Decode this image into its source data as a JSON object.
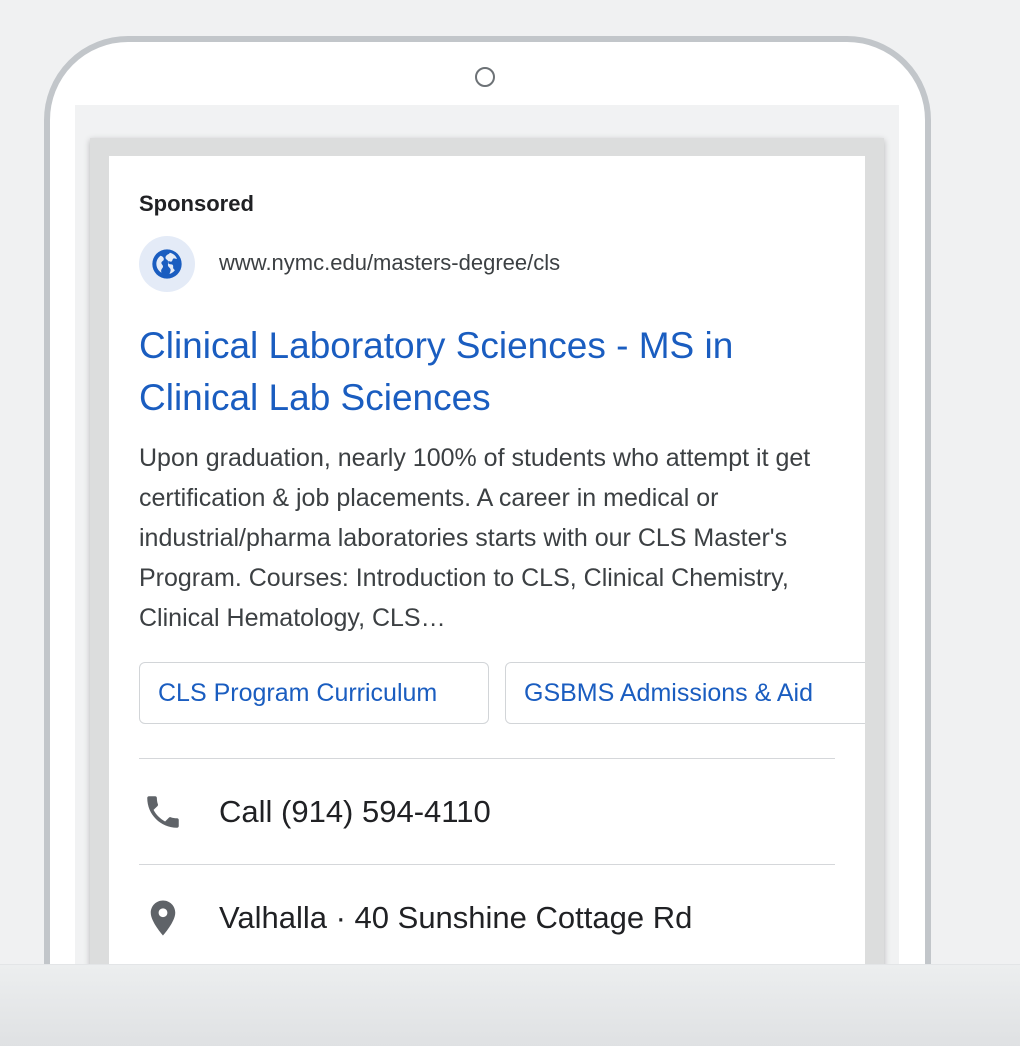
{
  "ad": {
    "sponsored_label": "Sponsored",
    "display_url": "www.nymc.edu/masters-degree/cls",
    "headline": "Clinical Laboratory Sciences - MS in Clinical Lab Sciences",
    "description": "Upon graduation, nearly 100% of students who attempt it get certification & job placements. A career in medical or industrial/pharma laboratories starts with our CLS Master's Program. Courses: Introduction to CLS, Clinical Chemistry, Clinical Hematology, CLS…",
    "sitelinks": [
      {
        "label": "CLS Program Curriculum"
      },
      {
        "label": "GSBMS Admissions & Aid"
      }
    ],
    "call_extension": {
      "icon": "phone-icon",
      "label": "Call (914) 594-4110"
    },
    "location_extension": {
      "icon": "map-pin-icon",
      "label": "Valhalla · 40 Sunshine Cottage Rd"
    }
  },
  "colors": {
    "link_blue": "#1a5dc0",
    "text_dark": "#202124",
    "text_body": "#3c4043",
    "icon_gray": "#5f6368",
    "favicon_bg": "#e4ebf7"
  }
}
